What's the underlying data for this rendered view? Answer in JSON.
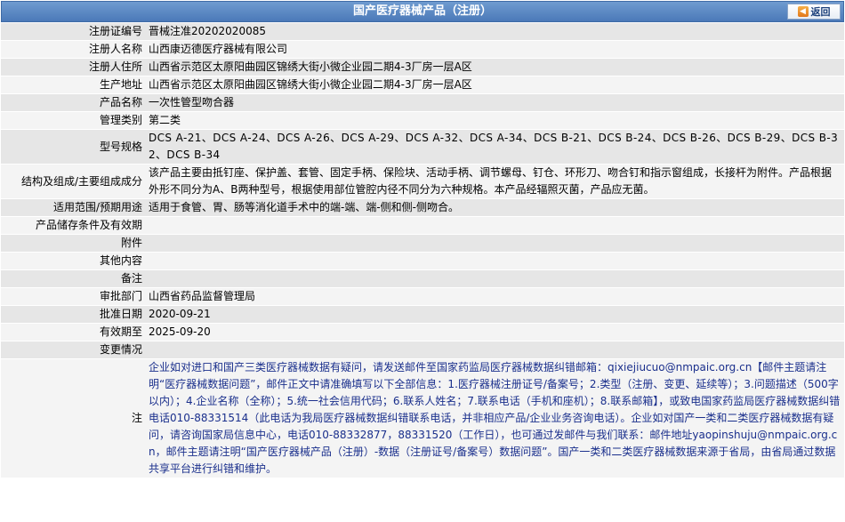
{
  "header": {
    "title": "国产医疗器械产品（注册）",
    "back_label": "返回"
  },
  "fields": {
    "reg_no": {
      "label": "注册证编号",
      "value": "晋械注准20202020085"
    },
    "registrant": {
      "label": "注册人名称",
      "value": "山西康迈德医疗器械有限公司"
    },
    "registrant_addr": {
      "label": "注册人住所",
      "value": "山西省示范区太原阳曲园区锦绣大街小微企业园二期4-3厂房一层A区"
    },
    "production_addr": {
      "label": "生产地址",
      "value": "山西省示范区太原阳曲园区锦绣大街小微企业园二期4-3厂房一层A区"
    },
    "product_name": {
      "label": "产品名称",
      "value": "一次性管型吻合器"
    },
    "category": {
      "label": "管理类别",
      "value": "第二类"
    },
    "models": {
      "label": "型号规格",
      "value": "DCS A-21、DCS A-24、DCS A-26、DCS A-29、DCS A-32、DCS A-34、DCS B-21、DCS B-24、DCS B-26、DCS B-29、DCS B-32、DCS B-34"
    },
    "composition": {
      "label": "结构及组成/主要组成成分",
      "value": "该产品主要由抵钉座、保护盖、套管、固定手柄、保险块、活动手柄、调节螺母、钉仓、环形刀、吻合钉和指示窗组成，长接杆为附件。产品根据外形不同分为A、B两种型号，根据使用部位管腔内径不同分为六种规格。本产品经辐照灭菌，产品应无菌。"
    },
    "scope": {
      "label": "适用范围/预期用途",
      "value": "适用于食管、胃、肠等消化道手术中的端-端、端-侧和侧-侧吻合。"
    },
    "storage": {
      "label": "产品储存条件及有效期",
      "value": ""
    },
    "attachment": {
      "label": "附件",
      "value": ""
    },
    "other": {
      "label": "其他内容",
      "value": ""
    },
    "remarks": {
      "label": "备注",
      "value": ""
    },
    "approval_dept": {
      "label": "审批部门",
      "value": "山西省药品监督管理局"
    },
    "approval_date": {
      "label": "批准日期",
      "value": "2020-09-21"
    },
    "valid_until": {
      "label": "有效期至",
      "value": "2025-09-20"
    },
    "change_info": {
      "label": "变更情况",
      "value": ""
    },
    "note": {
      "label": "注",
      "value": "企业如对进口和国产三类医疗器械数据有疑问，请发送邮件至国家药监局医疗器械数据纠错邮箱：qixiejiucuo@nmpaic.org.cn【邮件主题请注明“医疗器械数据问题”，邮件正文中请准确填写以下全部信息：1.医疗器械注册证号/备案号；2.类型（注册、变更、延续等）；3.问题描述（500字以内）；4.企业名称（全称）；5.统一社会信用代码；6.联系人姓名；7.联系电话（手机和座机）；8.联系邮箱】，或致电国家药监局医疗器械数据纠错电话010-88331514（此电话为我局医疗器械数据纠错联系电话，并非相应产品/企业业务咨询电话）。企业如对国产一类和二类医疗器械数据有疑问，请咨询国家局信息中心，电话010-88332877，88331520（工作日），也可通过发邮件与我们联系：邮件地址yaopinshuju@nmpaic.org.cn，邮件主题请注明“国产医疗器械产品（注册）-数据（注册证号/备案号）数据问题”。国产一类和二类医疗器械数据来源于省局，由省局通过数据共享平台进行纠错和维护。"
    }
  },
  "colors": {
    "header_bg": "#4b79b8",
    "row_odd": "#e6e6e6",
    "row_even": "#f4f4f4",
    "notice_text": "#1a2f8c"
  }
}
